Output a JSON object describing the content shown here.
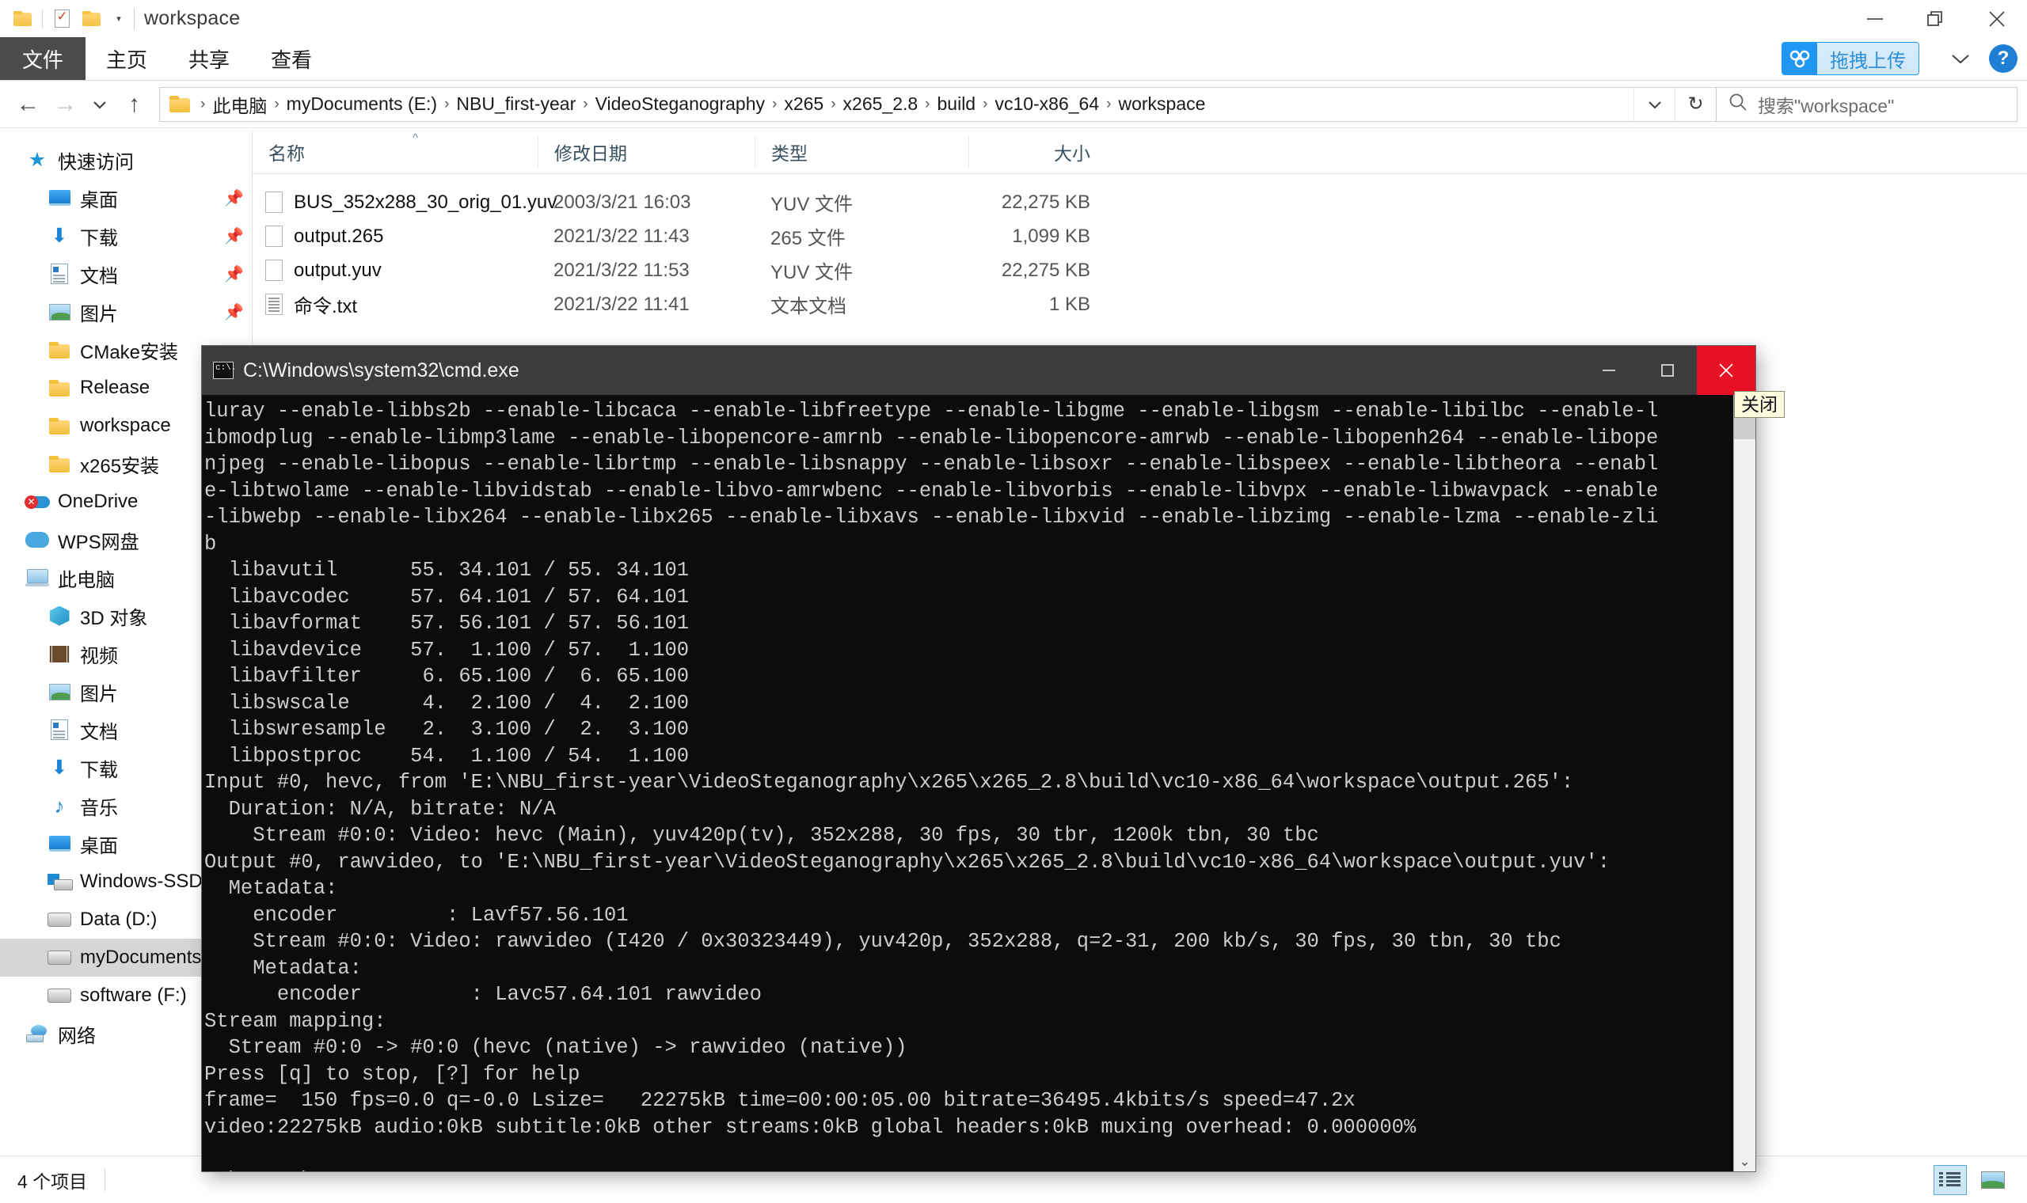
{
  "explorer": {
    "title": "workspace",
    "quick_access_toolbar": [
      {
        "name": "folder-icon",
        "label": ""
      },
      {
        "name": "properties-icon",
        "label": ""
      },
      {
        "name": "new-folder-icon",
        "label": ""
      },
      {
        "name": "customize-caret-icon",
        "label": "▾"
      }
    ],
    "window_controls": {
      "minimize": "—",
      "restore": "❐",
      "close": "✕"
    },
    "ribbon": {
      "file_tab": "文件",
      "tabs": [
        "主页",
        "共享",
        "查看"
      ],
      "upload_button": "拖拽上传",
      "ribbon_caret": "⌄",
      "help_button": "?"
    },
    "nav_buttons": {
      "back": "←",
      "forward": "→",
      "recent": "⌄",
      "up": "↑"
    },
    "address": {
      "crumbs": [
        "此电脑",
        "myDocuments (E:)",
        "NBU_first-year",
        "VideoSteganography",
        "x265",
        "x265_2.8",
        "build",
        "vc10-x86_64",
        "workspace"
      ],
      "separator": "›",
      "dropdown_caret": "⌄",
      "refresh": "↻"
    },
    "search": {
      "placeholder": "搜索\"workspace\"",
      "icon": "search-icon"
    },
    "nav_pane": [
      {
        "label": "快速访问",
        "icon": "star-icon",
        "level": 0,
        "pinned": false,
        "selected": false
      },
      {
        "label": "桌面",
        "icon": "desktop-icon",
        "level": 1,
        "pinned": true,
        "selected": false
      },
      {
        "label": "下载",
        "icon": "download-icon",
        "level": 1,
        "pinned": true,
        "selected": false
      },
      {
        "label": "文档",
        "icon": "document-icon",
        "level": 1,
        "pinned": true,
        "selected": false
      },
      {
        "label": "图片",
        "icon": "pictures-icon",
        "level": 1,
        "pinned": true,
        "selected": false
      },
      {
        "label": "CMake安装",
        "icon": "folder-icon",
        "level": 1,
        "pinned": false,
        "selected": false
      },
      {
        "label": "Release",
        "icon": "folder-icon",
        "level": 1,
        "pinned": false,
        "selected": false
      },
      {
        "label": "workspace",
        "icon": "folder-icon",
        "level": 1,
        "pinned": false,
        "selected": false
      },
      {
        "label": "x265安装",
        "icon": "folder-icon",
        "level": 1,
        "pinned": false,
        "selected": false
      },
      {
        "label": "OneDrive",
        "icon": "onedrive-error-icon",
        "level": 0,
        "pinned": false,
        "selected": false
      },
      {
        "label": "WPS网盘",
        "icon": "wps-cloud-icon",
        "level": 0,
        "pinned": false,
        "selected": false
      },
      {
        "label": "此电脑",
        "icon": "this-pc-icon",
        "level": 0,
        "pinned": false,
        "selected": false
      },
      {
        "label": "3D 对象",
        "icon": "3d-objects-icon",
        "level": 1,
        "pinned": false,
        "selected": false
      },
      {
        "label": "视频",
        "icon": "videos-icon",
        "level": 1,
        "pinned": false,
        "selected": false
      },
      {
        "label": "图片",
        "icon": "pictures-icon",
        "level": 1,
        "pinned": false,
        "selected": false
      },
      {
        "label": "文档",
        "icon": "document-icon",
        "level": 1,
        "pinned": false,
        "selected": false
      },
      {
        "label": "下载",
        "icon": "download-icon",
        "level": 1,
        "pinned": false,
        "selected": false
      },
      {
        "label": "音乐",
        "icon": "music-icon",
        "level": 1,
        "pinned": false,
        "selected": false
      },
      {
        "label": "桌面",
        "icon": "desktop-icon",
        "level": 1,
        "pinned": false,
        "selected": false
      },
      {
        "label": "Windows-SSD",
        "icon": "windows-drive-icon",
        "level": 1,
        "pinned": false,
        "selected": false
      },
      {
        "label": "Data (D:)",
        "icon": "drive-icon",
        "level": 1,
        "pinned": false,
        "selected": false
      },
      {
        "label": "myDocuments (E:)",
        "icon": "drive-icon",
        "level": 1,
        "pinned": false,
        "selected": true
      },
      {
        "label": "software (F:)",
        "icon": "drive-icon",
        "level": 1,
        "pinned": false,
        "selected": false
      },
      {
        "label": "网络",
        "icon": "network-icon",
        "level": 0,
        "pinned": false,
        "selected": false
      }
    ],
    "columns": [
      "名称",
      "修改日期",
      "类型",
      "大小"
    ],
    "sort_indicator": "^",
    "files": [
      {
        "name": "BUS_352x288_30_orig_01.yuv",
        "date": "2003/3/21 16:03",
        "type": "YUV 文件",
        "size": "22,275 KB",
        "icon": "file-icon"
      },
      {
        "name": "output.265",
        "date": "2021/3/22 11:43",
        "type": "265 文件",
        "size": "1,099 KB",
        "icon": "file-icon"
      },
      {
        "name": "output.yuv",
        "date": "2021/3/22 11:53",
        "type": "YUV 文件",
        "size": "22,275 KB",
        "icon": "file-icon"
      },
      {
        "name": "命令.txt",
        "date": "2021/3/22 11:41",
        "type": "文本文档",
        "size": "1 KB",
        "icon": "text-file-icon"
      }
    ],
    "status": {
      "item_count": "4 个项目"
    },
    "view_buttons": [
      {
        "name": "details-view-button",
        "active": true
      },
      {
        "name": "thumbnail-view-button",
        "active": false
      }
    ]
  },
  "cmd": {
    "title": "C:\\Windows\\system32\\cmd.exe",
    "window_controls": {
      "minimize": "–",
      "maximize": "❐",
      "close": "✕"
    },
    "tooltip": "关闭",
    "scrollbar": {
      "down_arrow": "⌄"
    },
    "output": "luray --enable-libbs2b --enable-libcaca --enable-libfreetype --enable-libgme --enable-libgsm --enable-libilbc --enable-l\nibmodplug --enable-libmp3lame --enable-libopencore-amrnb --enable-libopencore-amrwb --enable-libopenh264 --enable-libope\nnjpeg --enable-libopus --enable-librtmp --enable-libsnappy --enable-libsoxr --enable-libspeex --enable-libtheora --enabl\ne-libtwolame --enable-libvidstab --enable-libvo-amrwbenc --enable-libvorbis --enable-libvpx --enable-libwavpack --enable\n-libwebp --enable-libx264 --enable-libx265 --enable-libxavs --enable-libxvid --enable-libzimg --enable-lzma --enable-zli\nb\n  libavutil      55. 34.101 / 55. 34.101\n  libavcodec     57. 64.101 / 57. 64.101\n  libavformat    57. 56.101 / 57. 56.101\n  libavdevice    57.  1.100 / 57.  1.100\n  libavfilter     6. 65.100 /  6. 65.100\n  libswscale      4.  2.100 /  4.  2.100\n  libswresample   2.  3.100 /  2.  3.100\n  libpostproc    54.  1.100 / 54.  1.100\nInput #0, hevc, from 'E:\\NBU_first-year\\VideoSteganography\\x265\\x265_2.8\\build\\vc10-x86_64\\workspace\\output.265':\n  Duration: N/A, bitrate: N/A\n    Stream #0:0: Video: hevc (Main), yuv420p(tv), 352x288, 30 fps, 30 tbr, 1200k tbn, 30 tbc\nOutput #0, rawvideo, to 'E:\\NBU_first-year\\VideoSteganography\\x265\\x265_2.8\\build\\vc10-x86_64\\workspace\\output.yuv':\n  Metadata:\n    encoder         : Lavf57.56.101\n    Stream #0:0: Video: rawvideo (I420 / 0x30323449), yuv420p, 352x288, q=2-31, 200 kb/s, 30 fps, 30 tbn, 30 tbc\n    Metadata:\n      encoder         : Lavc57.64.101 rawvideo\nStream mapping:\n  Stream #0:0 -> #0:0 (hevc (native) -> rawvideo (native))\nPress [q] to stop, [?] for help\nframe=  150 fps=0.0 q=-0.0 Lsize=   22275kB time=00:00:05.00 bitrate=36495.4kbits/s speed=47.2x\nvideo:22275kB audio:0kB subtitle:0kB other streams:0kB global headers:0kB muxing overhead: 0.000000%\n\nC:\\Users\\PC_ycq>"
  }
}
